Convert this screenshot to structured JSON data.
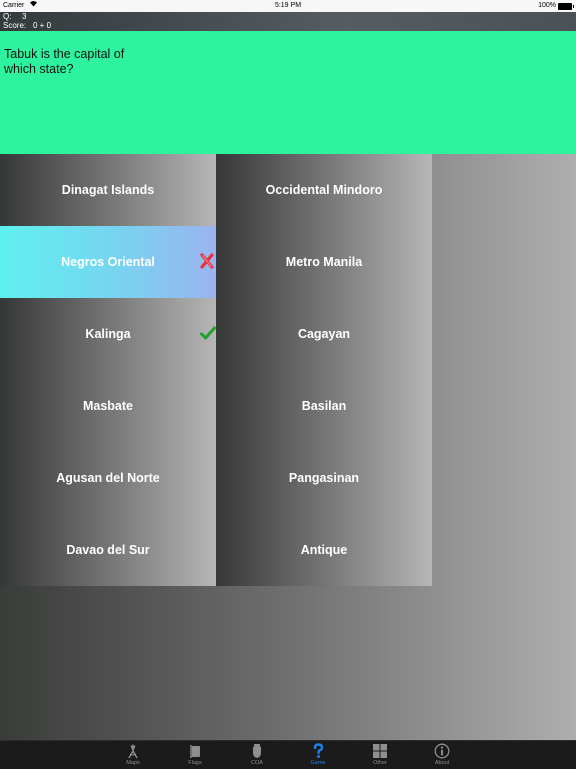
{
  "status_bar": {
    "carrier": "Carrier",
    "time": "5:19 PM",
    "battery": "100%"
  },
  "info": {
    "q_label": "Q:",
    "q_value": "3",
    "score_label": "Score:",
    "score_value": "0 + 0"
  },
  "question": {
    "text": "Tabuk is the capital of which state?"
  },
  "answers": {
    "left": [
      {
        "label": "Dinagat Islands"
      },
      {
        "label": "Negros Oriental",
        "state": "wrong"
      },
      {
        "label": "Kalinga",
        "state": "correct"
      },
      {
        "label": "Masbate"
      },
      {
        "label": "Agusan del Norte"
      },
      {
        "label": "Davao del Sur"
      }
    ],
    "right": [
      {
        "label": "Occidental Mindoro"
      },
      {
        "label": "Metro Manila"
      },
      {
        "label": "Cagayan"
      },
      {
        "label": "Basilan"
      },
      {
        "label": "Pangasinan"
      },
      {
        "label": "Antique"
      }
    ]
  },
  "colors": {
    "question_bg": "#2ef39e",
    "selected_bg": "#5ff0f1",
    "wrong_mark": "#e8333a",
    "correct_mark": "#1fa12b",
    "tab_active": "#1d7fe8"
  },
  "tabs": [
    {
      "label": "Maps",
      "icon": "compass-icon"
    },
    {
      "label": "Flags",
      "icon": "flag-icon"
    },
    {
      "label": "COA",
      "icon": "shield-icon"
    },
    {
      "label": "Game",
      "icon": "question-mark-icon",
      "active": true
    },
    {
      "label": "Other",
      "icon": "grid-icon"
    },
    {
      "label": "About",
      "icon": "info-icon"
    }
  ]
}
